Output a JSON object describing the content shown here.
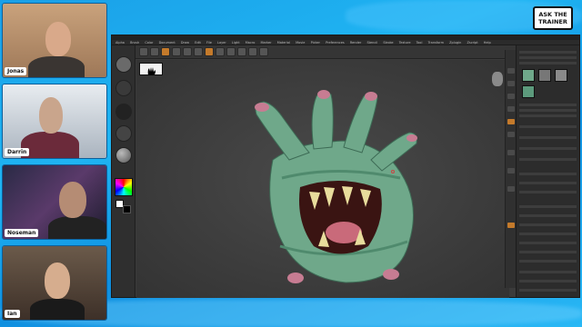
{
  "badge": {
    "line1": "ASK THE",
    "line2": "TRAINER"
  },
  "participants": [
    {
      "name": "Jonas"
    },
    {
      "name": "Darrin"
    },
    {
      "name": "Noseman"
    },
    {
      "name": "Ian"
    }
  ],
  "app": {
    "menu": [
      "Alpha",
      "Brush",
      "Color",
      "Document",
      "Draw",
      "Edit",
      "File",
      "Layer",
      "Light",
      "Macro",
      "Marker",
      "Material",
      "Movie",
      "Picker",
      "Preferences",
      "Render",
      "Stencil",
      "Stroke",
      "Texture",
      "Tool",
      "Transform",
      "Zplugin",
      "Zscript",
      "Help"
    ]
  },
  "colors": {
    "accent": "#c47a2b",
    "background": "#1aa0e8",
    "model_green": "#6fa88a",
    "model_pink": "#c77c92"
  }
}
